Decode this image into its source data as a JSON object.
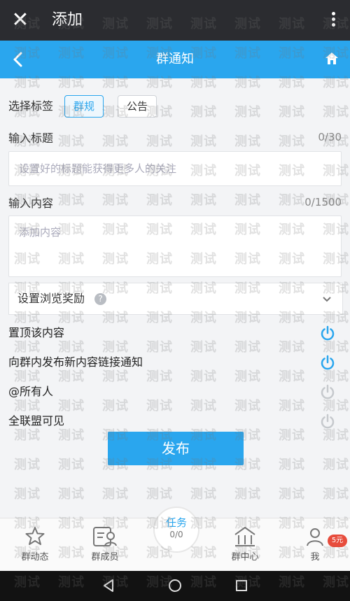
{
  "topbar": {
    "title": "添加"
  },
  "header": {
    "title": "群通知"
  },
  "form": {
    "tag_label": "选择标签",
    "tags": [
      {
        "label": "群规",
        "active": true
      },
      {
        "label": "公告",
        "active": false
      }
    ],
    "title_label": "输入标题",
    "title_counter": "0/30",
    "title_placeholder": "设置好的标题能获得更多人的关注",
    "content_label": "输入内容",
    "content_counter": "0/1500",
    "content_placeholder": "添加内容",
    "reward_label": "设置浏览奖励",
    "toggles": [
      {
        "label": "置顶该内容",
        "on": true
      },
      {
        "label": "向群内发布新内容链接通知",
        "on": true
      },
      {
        "label": "@所有人",
        "on": false
      },
      {
        "label": "全联盟可见",
        "on": false
      }
    ],
    "publish_label": "发布"
  },
  "tabbar": {
    "items": [
      {
        "label": "群动态",
        "icon": "star-icon"
      },
      {
        "label": "群成员",
        "icon": "member-icon"
      },
      {
        "label": "群中心",
        "icon": "building-icon"
      },
      {
        "label": "我",
        "icon": "profile-icon"
      }
    ],
    "task": {
      "label": "任务",
      "progress": "0/0"
    },
    "badge": "5元"
  },
  "watermark_text": "测试",
  "colors": {
    "accent": "#2aa6ee",
    "topbar": "#2b2c30"
  }
}
